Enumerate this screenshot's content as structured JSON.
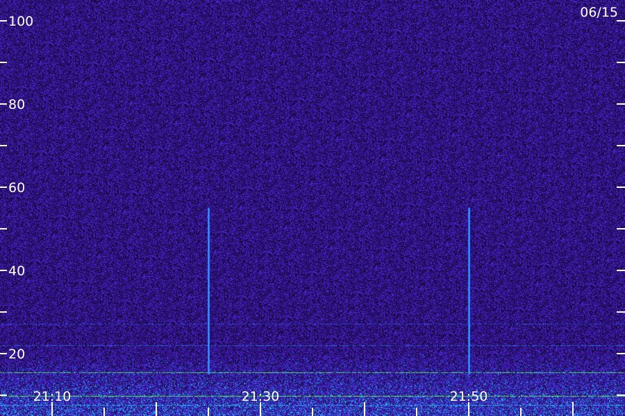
{
  "chart_data": {
    "type": "heatmap",
    "corner_label": "06/15",
    "y_ticks": [
      "100",
      "80",
      "60",
      "40",
      "20"
    ],
    "y_range": [
      0,
      110
    ],
    "x_ticks": [
      "21:10",
      "21:30",
      "21:50"
    ],
    "x_range": [
      "21:05",
      "22:05"
    ],
    "vertical_events": [
      {
        "time": "21:25",
        "top_value": 55
      },
      {
        "time": "21:50",
        "top_value": 55
      }
    ],
    "colors": {
      "background": "#1a0a4a",
      "noise_low": "#3a1a9a",
      "noise_high": "#6a40ff",
      "event": "#3aa0ff",
      "band": "#20e0ff",
      "band_bright": "#a0ff60"
    }
  }
}
